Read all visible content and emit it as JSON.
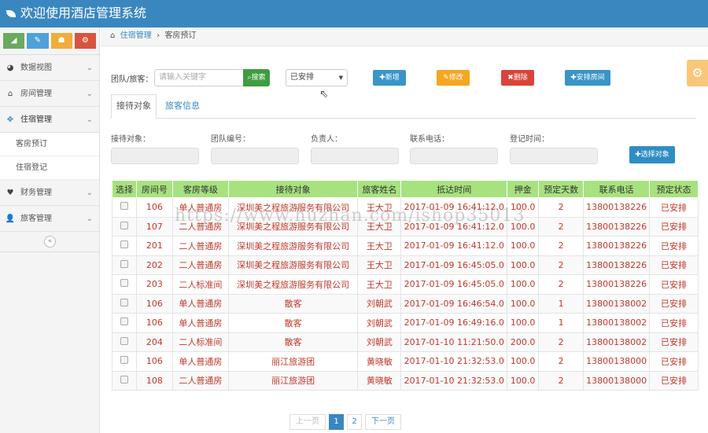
{
  "header": {
    "title": "欢迎使用酒店管理系统"
  },
  "sidebar": {
    "items": [
      {
        "label": "数据视图",
        "icon": "dashboard-icon"
      },
      {
        "label": "房间管理",
        "icon": "home-icon"
      },
      {
        "label": "住宿管理",
        "icon": "move-icon"
      },
      {
        "label": "财务管理",
        "icon": "heart-icon"
      },
      {
        "label": "旅客管理",
        "icon": "user-icon"
      }
    ],
    "sub_items": [
      "客房预订",
      "住宿登记"
    ],
    "collapse": "«"
  },
  "breadcrumb": {
    "parent": "住宿管理",
    "current": "客房预订"
  },
  "search": {
    "label": "团队/旅客：",
    "placeholder": "请输入关键字",
    "button": "搜索",
    "select_value": "已安排"
  },
  "toolbar": {
    "add": "新增",
    "edit": "修改",
    "delete": "删除",
    "arrange": "安排房间"
  },
  "tabs": [
    "接待对象",
    "旅客信息"
  ],
  "form": {
    "labels": [
      "接待对象：",
      "团队编号：",
      "负责人：",
      "联系电话：",
      "登记时间："
    ],
    "select_button": "选择对象"
  },
  "table": {
    "headers": [
      "选择",
      "房间号",
      "客房等级",
      "接待对象",
      "旅客姓名",
      "抵达时间",
      "押金",
      "预定天数",
      "联系电话",
      "预定状态"
    ],
    "rows": [
      [
        "106",
        "单人普通房",
        "深圳美之程旅游服务有限公司",
        "王大卫",
        "2017-01-09 16:41:12.0",
        "100.0",
        "2",
        "13800138226",
        "已安排"
      ],
      [
        "107",
        "二人普通房",
        "深圳美之程旅游服务有限公司",
        "王大卫",
        "2017-01-09 16:41:12.0",
        "100.0",
        "2",
        "13800138226",
        "已安排"
      ],
      [
        "201",
        "二人普通房",
        "深圳美之程旅游服务有限公司",
        "王大卫",
        "2017-01-09 16:41:12.0",
        "100.0",
        "2",
        "13800138226",
        "已安排"
      ],
      [
        "202",
        "二人普通房",
        "深圳美之程旅游服务有限公司",
        "王大卫",
        "2017-01-09 16:45:05.0",
        "100.0",
        "2",
        "13800138226",
        "已安排"
      ],
      [
        "203",
        "二人标准间",
        "深圳美之程旅游服务有限公司",
        "王大卫",
        "2017-01-09 16:45:05.0",
        "100.0",
        "2",
        "13800138226",
        "已安排"
      ],
      [
        "106",
        "单人普通房",
        "散客",
        "刘朝武",
        "2017-01-09 16:46:54.0",
        "100.0",
        "1",
        "13800138002",
        "已安排"
      ],
      [
        "106",
        "单人普通房",
        "散客",
        "刘朝武",
        "2017-01-09 16:49:16.0",
        "100.0",
        "1",
        "13800138002",
        "已安排"
      ],
      [
        "204",
        "二人标准间",
        "散客",
        "刘朝武",
        "2017-01-10 11:21:50.0",
        "200.0",
        "2",
        "13800138002",
        "已安排"
      ],
      [
        "106",
        "单人普通房",
        "丽江旅游团",
        "黄晓敏",
        "2017-01-10 21:32:53.0",
        "100.0",
        "2",
        "13800138000",
        "已安排"
      ],
      [
        "108",
        "二人普通房",
        "丽江旅游团",
        "黄晓敏",
        "2017-01-10 21:32:53.0",
        "100.0",
        "2",
        "13800138000",
        "已安排"
      ]
    ]
  },
  "pagination": {
    "prev": "上一页",
    "pages": [
      "1",
      "2"
    ],
    "current": "1",
    "next": "下一页"
  },
  "watermark": "https://www.huzhan.com/ishop35013"
}
